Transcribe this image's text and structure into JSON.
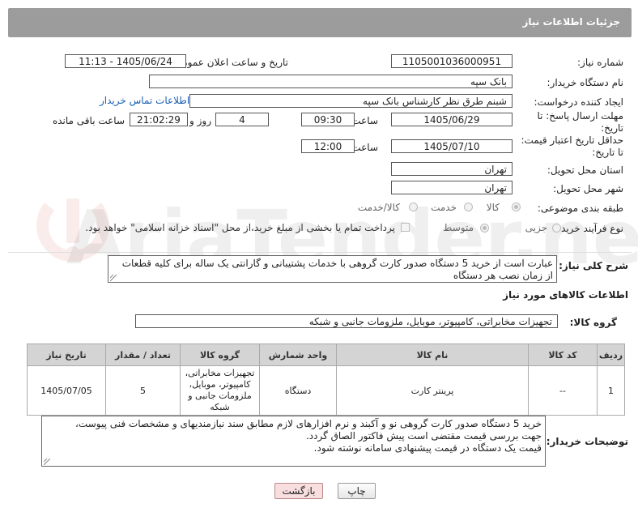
{
  "header": {
    "title": "جزئیات اطلاعات نیاز"
  },
  "form": {
    "need_number_label": "شماره نیاز:",
    "need_number": "1105001036000951",
    "announce_label": "تاریخ و ساعت اعلان عمومی:",
    "announce_value": "1405/06/24 - 11:13",
    "buyer_org_label": "نام دستگاه خریدار:",
    "buyer_org": "بانک سپه",
    "requester_label": "ایجاد کننده درخواست:",
    "requester": "شبنم طرق نظر کارشناس بانک سپه",
    "contact_link": "اطلاعات تماس خریدار",
    "deadline_label": "مهلت ارسال پاسخ: تا تاریخ:",
    "deadline_date": "1405/06/29",
    "time_label": "ساعت",
    "deadline_time": "09:30",
    "days_value": "4",
    "days_label": "روز و",
    "remaining_time": "21:02:29",
    "remaining_label": "ساعت باقی مانده",
    "validity_label": "حداقل تاریخ اعتبار قیمت: تا تاریخ:",
    "validity_date": "1405/07/10",
    "validity_time": "12:00",
    "province_label": "استان محل تحویل:",
    "province": "تهران",
    "city_label": "شهر محل تحویل:",
    "city": "تهران",
    "category_label": "طبقه بندی موضوعی:",
    "category_options": [
      "کالا",
      "خدمت",
      "کالا/خدمت"
    ],
    "process_label": "نوع فرآیند خرید :",
    "process_options": [
      "جزیی",
      "متوسط"
    ],
    "payment_text": "پرداخت تمام یا بخشی از مبلغ خرید،از محل \"اسناد خزانه اسلامی\" خواهد بود."
  },
  "summary": {
    "label": "شرح کلی نیاز:",
    "text": "عبارت است از خرید 5 دستگاه صدور کارت گروهی با خدمات پشتیبانی و گارانتی یک ساله برای کلیه قطعات از زمان نصب هر دستگاه"
  },
  "goods_section": {
    "title": "اطلاعات کالاهای مورد نیاز",
    "group_label": "گروه کالا:",
    "group_value": "تجهیزات مخابراتی، کامپیوتر، موبایل، ملزومات جانبی و شبکه"
  },
  "table": {
    "headers": [
      "ردیف",
      "کد کالا",
      "نام کالا",
      "واحد شمارش",
      "گروه کالا",
      "تعداد / مقدار",
      "تاریخ نیاز"
    ],
    "rows": [
      [
        "1",
        "--",
        "پرینتر کارت",
        "دستگاه",
        "تجهیزات مخابراتی، کامپیوتر، موبایل، ملزومات جانبی و شبکه",
        "5",
        "1405/07/05"
      ]
    ]
  },
  "buyer_notes": {
    "label": "توضیحات خریدار:",
    "lines": [
      "خرید 5 دستگاه صدور کارت گروهی نو و آکبند و نرم افزارهای لازم  مطابق سند نیازمندیهای و مشخصات فنی پیوست،",
      "جهت بررسی قیمت مقتضی است پیش فاکتور الصاق گردد.",
      "قیمت یک دستگاه در قیمت پیشنهادی سامانه نوشته شود."
    ]
  },
  "buttons": {
    "print": "چاپ",
    "back": "بازگشت"
  },
  "colors": {
    "header_bg": "#9c9c9c",
    "link": "#1a5fb4",
    "back_btn_bg": "#f8dede"
  }
}
